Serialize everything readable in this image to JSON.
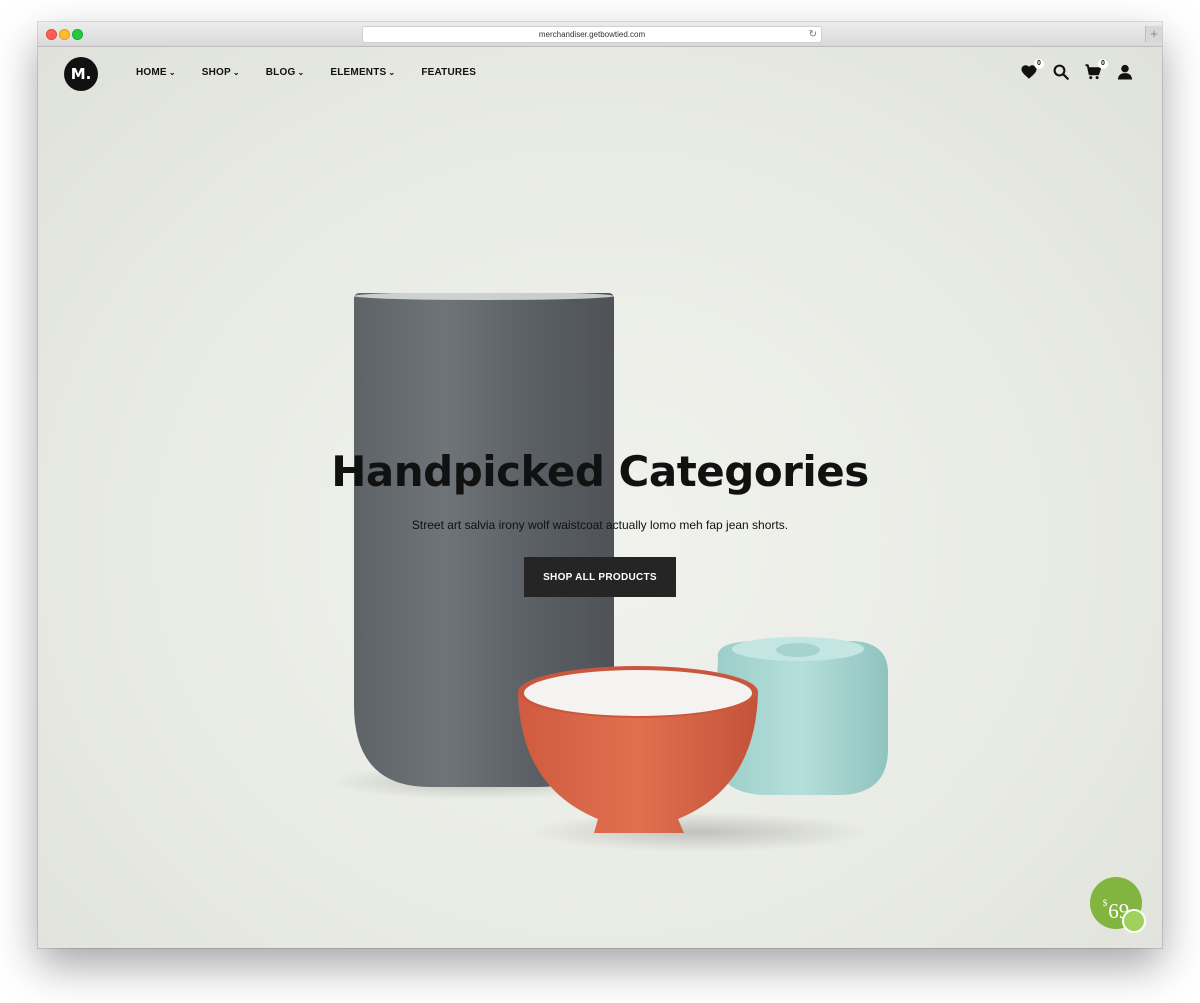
{
  "browser": {
    "url": "merchandiser.getbowtied.com",
    "new_tab_label": "+"
  },
  "logo": {
    "text": "M."
  },
  "nav": [
    {
      "label": "HOME",
      "has_dropdown": true
    },
    {
      "label": "SHOP",
      "has_dropdown": true
    },
    {
      "label": "BLOG",
      "has_dropdown": true
    },
    {
      "label": "ELEMENTS",
      "has_dropdown": true
    },
    {
      "label": "FEATURES",
      "has_dropdown": false
    }
  ],
  "header_icons": {
    "wishlist": {
      "icon": "heart-icon",
      "count": "0"
    },
    "search": {
      "icon": "search-icon"
    },
    "cart": {
      "icon": "cart-icon",
      "count": "0"
    },
    "account": {
      "icon": "user-icon"
    }
  },
  "hero": {
    "title": "Handpicked Categories",
    "subtitle": "Street art salvia irony wolf waistcoat actually lomo meh fap jean shorts.",
    "cta": "SHOP ALL PRODUCTS"
  },
  "price_badge": {
    "currency": "$",
    "amount": "69"
  },
  "colors": {
    "vase": "#5f6469",
    "bowl": "#d9664a",
    "teal_cup": "#a8d6d2",
    "badge": "#82b440",
    "button": "#252525"
  }
}
